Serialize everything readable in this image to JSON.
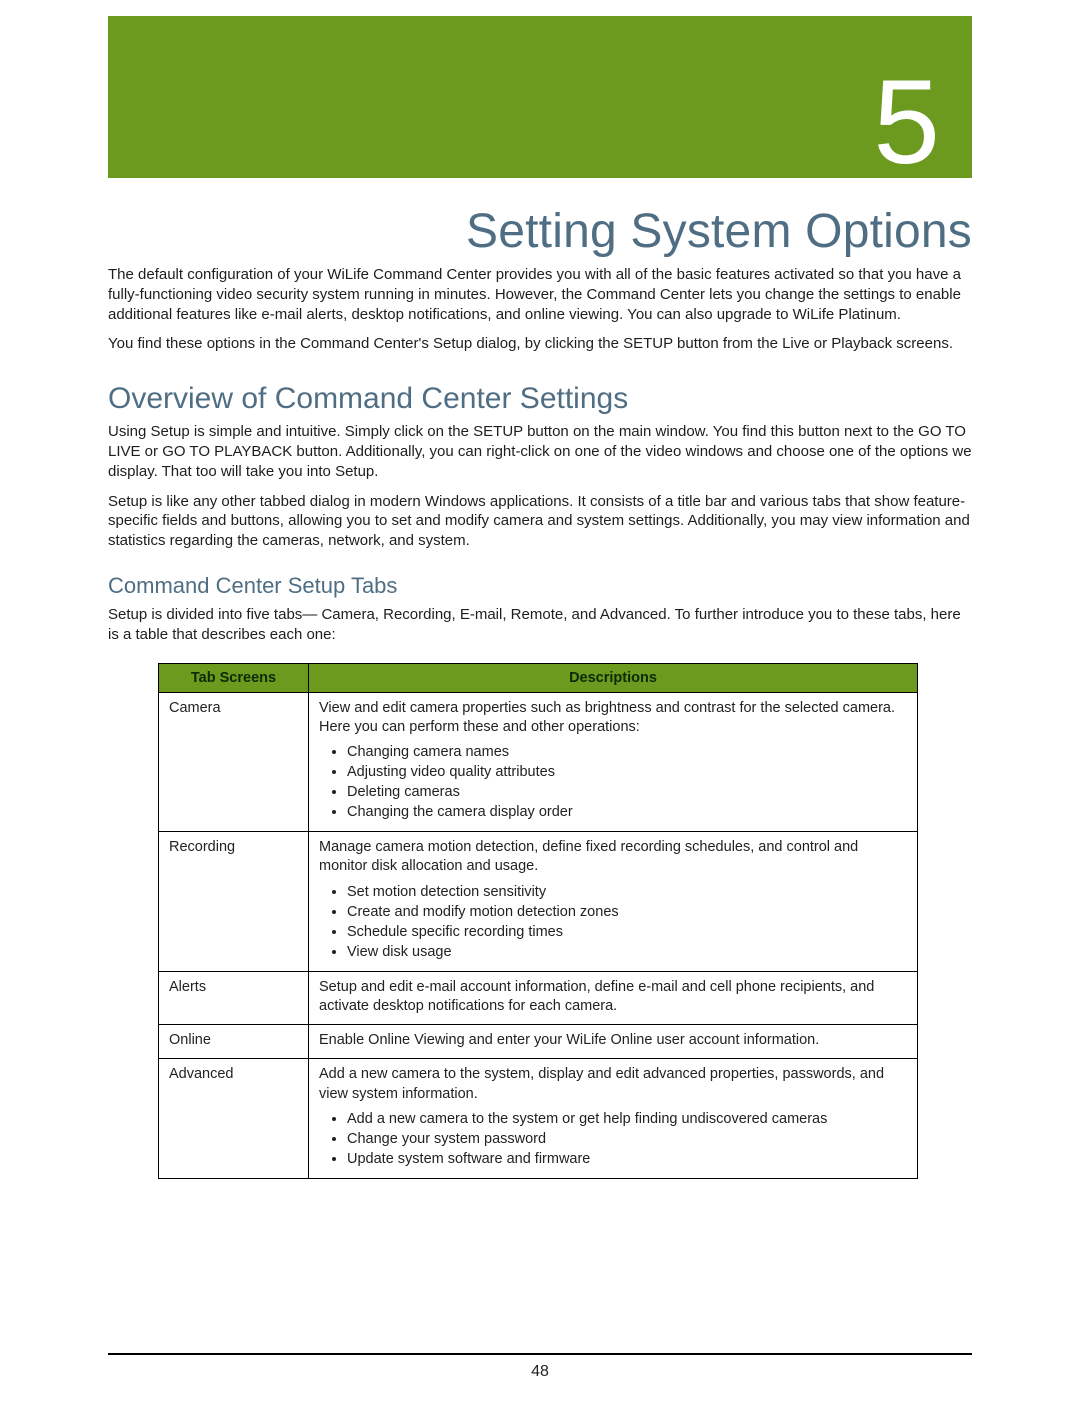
{
  "chapter_number": "5",
  "chapter_title": "Setting System Options",
  "intro_paragraphs": [
    "The default configuration of your WiLife Command Center provides you with all of the basic features activated so that you have a fully-functioning video security system running in minutes. However, the Command Center lets you change the settings to enable additional features like e-mail alerts, desktop notifications, and online viewing.  You can also upgrade to WiLife Platinum.",
    "You find these options in the Command Center's Setup dialog, by clicking the SETUP button from the Live or Playback screens."
  ],
  "section_heading": "Overview of Command Center Settings",
  "section_paragraphs": [
    "Using Setup is simple and intuitive.  Simply click on the SETUP button on the main window. You find this button next to the GO TO LIVE or GO TO PLAYBACK button.  Additionally, you can right-click on one of the video windows and choose one of the options we display. That too will take you into Setup.",
    "Setup is like any other tabbed dialog in modern Windows applications.  It consists of a title bar and various tabs that show feature-specific fields and buttons, allowing you to set and modify camera and system settings. Additionally, you may view information and statistics regarding the cameras, network, and system."
  ],
  "subsection_heading": "Command Center Setup Tabs",
  "subsection_paragraphs": [
    "Setup is divided into five tabs— Camera, Recording, E-mail, Remote, and Advanced. To further introduce you to these tabs, here is a table that describes each one:"
  ],
  "table": {
    "headers": {
      "col_name": "Tab Screens",
      "col_desc": "Descriptions"
    },
    "rows": [
      {
        "name": "Camera",
        "desc": "View and edit camera properties such as brightness and contrast for the selected camera. Here you can perform these and other operations:",
        "bullets": [
          "Changing camera names",
          "Adjusting video quality attributes",
          "Deleting cameras",
          "Changing the camera display order"
        ]
      },
      {
        "name": "Recording",
        "desc": "Manage camera motion detection, define fixed recording schedules, and control and monitor disk allocation and usage.",
        "bullets": [
          "Set motion detection sensitivity",
          "Create and modify motion detection zones",
          "Schedule specific recording times",
          "View disk usage"
        ]
      },
      {
        "name": "Alerts",
        "desc": "Setup and edit e-mail account information, define e-mail and cell phone recipients, and activate desktop notifications for each camera.",
        "bullets": []
      },
      {
        "name": "Online",
        "desc": "Enable Online Viewing and enter your WiLife Online user account information.",
        "bullets": []
      },
      {
        "name": "Advanced",
        "desc": "Add a new camera to the system, display and edit advanced properties, passwords, and view system information.",
        "bullets": [
          "Add a new camera to the system or get help finding undiscovered cameras",
          "Change your system password",
          "Update system software and firmware"
        ]
      }
    ]
  },
  "page_number": "48"
}
